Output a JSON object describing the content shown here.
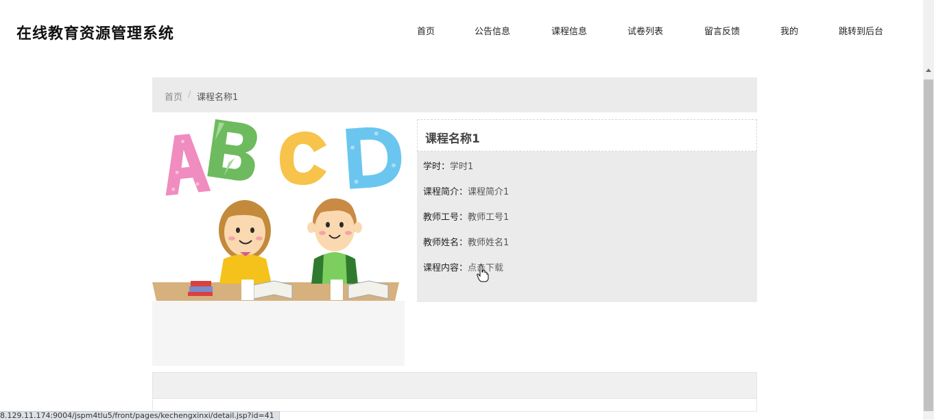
{
  "header": {
    "site_title": "在线教育资源管理系统",
    "nav": [
      {
        "label": "首页"
      },
      {
        "label": "公告信息"
      },
      {
        "label": "课程信息"
      },
      {
        "label": "试卷列表"
      },
      {
        "label": "留言反馈"
      },
      {
        "label": "我的"
      },
      {
        "label": "跳转到后台"
      }
    ]
  },
  "breadcrumb": {
    "home": "首页",
    "separator": "/",
    "current": "课程名称1"
  },
  "course": {
    "title": "课程名称1",
    "hours_label": "学时：",
    "hours_value": "学时1",
    "intro_label": "课程简介：",
    "intro_value": "课程简介1",
    "teacher_id_label": "教师工号：",
    "teacher_id_value": "教师工号1",
    "teacher_name_label": "教师姓名：",
    "teacher_name_value": "教师姓名1",
    "content_label": "课程内容：",
    "content_link": "点击下载"
  },
  "status_bar": {
    "url": "8.129.11.174:9004/jspm4tlu5/front/pages/kechengxinxi/detail.jsp?id=41"
  },
  "colors": {
    "panel_bg": "#ebebeb",
    "title_text": "#111111",
    "scrollbar_thumb": "#c1c1c1"
  }
}
